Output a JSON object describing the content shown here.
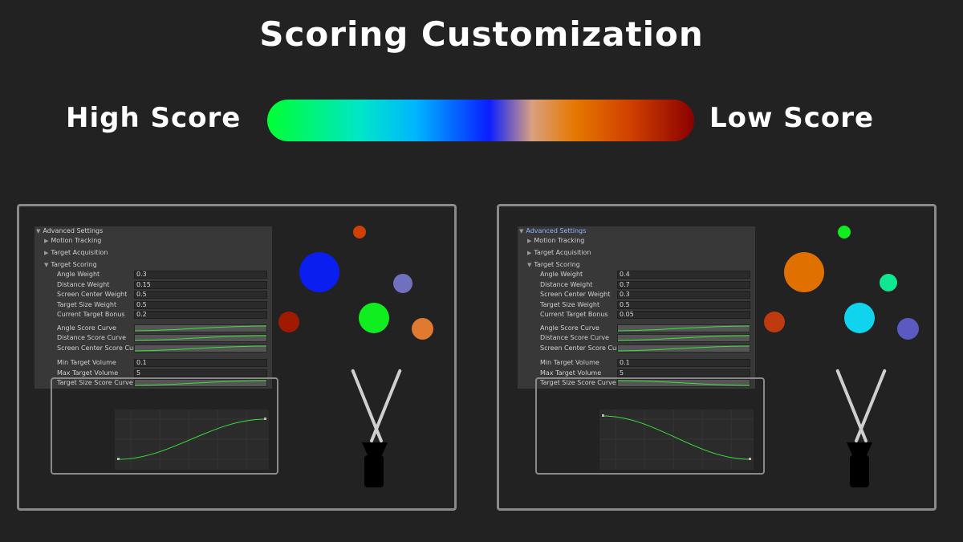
{
  "title": "Scoring Customization",
  "legend": {
    "high_label": "High Score",
    "low_label": "Low Score",
    "gradient_colors": [
      "#00ff33",
      "#00e6c8",
      "#00b4ff",
      "#0a1eff",
      "#d9a080",
      "#e67800",
      "#d04000",
      "#8a0000"
    ]
  },
  "panels": [
    {
      "advanced_settings": "Advanced Settings",
      "motion_tracking": "Motion Tracking",
      "target_acquisition": "Target Acquisition",
      "target_scoring": "Target Scoring",
      "angle_weight_label": "Angle Weight",
      "angle_weight": "0.3",
      "distance_weight_label": "Distance Weight",
      "distance_weight": "0.15",
      "screen_center_weight_label": "Screen Center Weight",
      "screen_center_weight": "0.5",
      "target_size_weight_label": "Target Size Weight",
      "target_size_weight": "0.5",
      "current_target_bonus_label": "Current Target Bonus",
      "current_target_bonus": "0.2",
      "angle_score_curve_label": "Angle Score Curve",
      "distance_score_curve_label": "Distance Score Curve",
      "screen_center_score_curve_label": "Screen Center Score Curve",
      "min_target_volume_label": "Min Target Volume",
      "min_target_volume": "0.1",
      "max_target_volume_label": "Max Target Volume",
      "max_target_volume": "5",
      "target_size_score_curve_label": "Target Size Score Curve",
      "target_size_curve_direction": "increasing",
      "circle_colors": [
        "#d04000",
        "#0a1eef",
        "#7070c0",
        "#a01a00",
        "#10ee20",
        "#e07a30"
      ]
    },
    {
      "advanced_settings": "Advanced Settings",
      "motion_tracking": "Motion Tracking",
      "target_acquisition": "Target Acquisition",
      "target_scoring": "Target Scoring",
      "angle_weight_label": "Angle Weight",
      "angle_weight": "0.4",
      "distance_weight_label": "Distance Weight",
      "distance_weight": "0.7",
      "screen_center_weight_label": "Screen Center Weight",
      "screen_center_weight": "0.3",
      "target_size_weight_label": "Target Size Weight",
      "target_size_weight": "0.5",
      "current_target_bonus_label": "Current Target Bonus",
      "current_target_bonus": "0.05",
      "angle_score_curve_label": "Angle Score Curve",
      "distance_score_curve_label": "Distance Score Curve",
      "screen_center_score_curve_label": "Screen Center Score Curve",
      "min_target_volume_label": "Min Target Volume",
      "min_target_volume": "0.1",
      "max_target_volume_label": "Max Target Volume",
      "max_target_volume": "5",
      "target_size_score_curve_label": "Target Size Score Curve",
      "target_size_curve_direction": "decreasing",
      "circle_colors": [
        "#10ee20",
        "#e07000",
        "#10e890",
        "#c03a10",
        "#10d4ee",
        "#5a5ac0"
      ]
    }
  ]
}
